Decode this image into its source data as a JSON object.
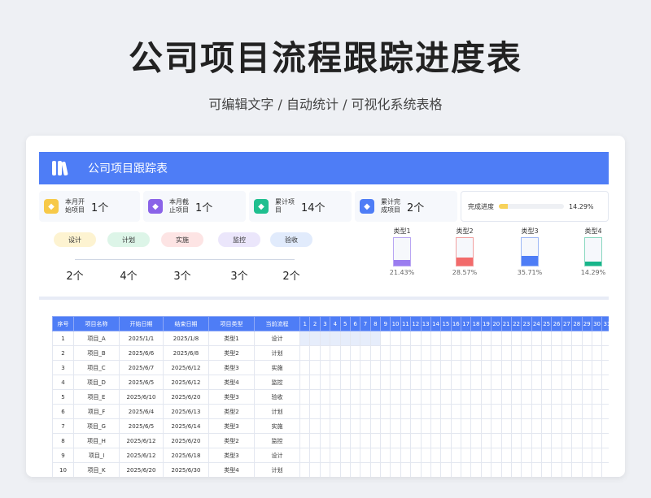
{
  "hero": {
    "title": "公司项目流程跟踪进度表",
    "subtitle": "可编辑文字 / 自动统计 / 可视化系统表格"
  },
  "banner": {
    "title": "公司项目跟踪表"
  },
  "stats": [
    {
      "label": "本月开始项目",
      "value": "1个",
      "icon": "star-icon",
      "color": "#f7c948"
    },
    {
      "label": "本月截止项目",
      "value": "1个",
      "icon": "layers-icon",
      "color": "#8a63e8"
    },
    {
      "label": "累计项目",
      "value": "14个",
      "icon": "layers-icon",
      "color": "#1fbf8f"
    },
    {
      "label": "累计完成项目",
      "value": "2个",
      "icon": "layers-icon",
      "color": "#4e7df6"
    }
  ],
  "progress": {
    "label": "完成进度",
    "value": "14.29%",
    "fraction": 0.1429
  },
  "flow": [
    {
      "label": "设计",
      "count": "2个",
      "color": "#fdf3d1"
    },
    {
      "label": "计划",
      "count": "4个",
      "color": "#ddf5e8"
    },
    {
      "label": "实施",
      "count": "3个",
      "color": "#fde4e4"
    },
    {
      "label": "监控",
      "count": "3个",
      "color": "#ebe6fb"
    },
    {
      "label": "验收",
      "count": "2个",
      "color": "#e1ebfc"
    }
  ],
  "types": [
    {
      "label": "类型1",
      "pct": "21.43%",
      "fraction": 0.2143,
      "color": "#9b7df0",
      "border": "#b9a6f3"
    },
    {
      "label": "类型2",
      "pct": "28.57%",
      "fraction": 0.2857,
      "color": "#f26b6b",
      "border": "#f2a0a0"
    },
    {
      "label": "类型3",
      "pct": "35.71%",
      "fraction": 0.3571,
      "color": "#4e7df6",
      "border": "#9db8f6"
    },
    {
      "label": "类型4",
      "pct": "14.29%",
      "fraction": 0.1429,
      "color": "#17b58a",
      "border": "#8ad8c0"
    }
  ],
  "table": {
    "headers": [
      "序号",
      "项目名称",
      "开始日期",
      "结束日期",
      "项目类型",
      "当前流程"
    ],
    "days": [
      "1",
      "2",
      "3",
      "4",
      "5",
      "6",
      "7",
      "8",
      "9",
      "10",
      "11",
      "12",
      "13",
      "14",
      "15",
      "16",
      "17",
      "18",
      "19",
      "20",
      "21",
      "22",
      "23",
      "24",
      "25",
      "26",
      "27",
      "28",
      "29",
      "30",
      "31"
    ],
    "rows": [
      [
        "1",
        "项目_A",
        "2025/1/1",
        "2025/1/8",
        "类型1",
        "设计"
      ],
      [
        "2",
        "项目_B",
        "2025/6/6",
        "2025/6/8",
        "类型2",
        "计划"
      ],
      [
        "3",
        "项目_C",
        "2025/6/7",
        "2025/6/12",
        "类型3",
        "实施"
      ],
      [
        "4",
        "项目_D",
        "2025/6/5",
        "2025/6/12",
        "类型4",
        "监控"
      ],
      [
        "5",
        "项目_E",
        "2025/6/10",
        "2025/6/20",
        "类型3",
        "验收"
      ],
      [
        "6",
        "项目_F",
        "2025/6/4",
        "2025/6/13",
        "类型2",
        "计划"
      ],
      [
        "7",
        "项目_G",
        "2025/6/5",
        "2025/6/14",
        "类型3",
        "实施"
      ],
      [
        "8",
        "项目_H",
        "2025/6/12",
        "2025/6/20",
        "类型2",
        "监控"
      ],
      [
        "9",
        "项目_I",
        "2025/6/12",
        "2025/6/18",
        "类型3",
        "设计"
      ],
      [
        "10",
        "项目_K",
        "2025/6/20",
        "2025/6/30",
        "类型4",
        "计划"
      ]
    ],
    "highlight_row": 0,
    "highlight_days": 8
  }
}
